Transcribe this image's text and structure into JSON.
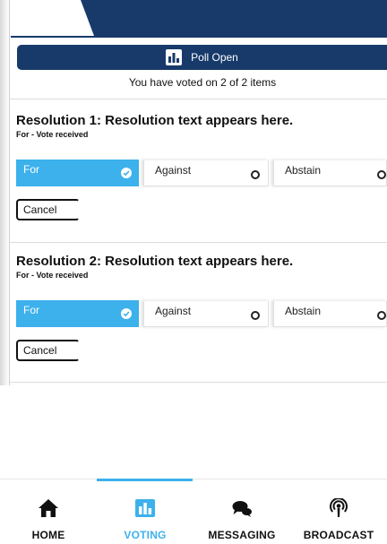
{
  "colors": {
    "navy": "#173a6a",
    "accent": "#3cb1ec",
    "text": "#111111"
  },
  "poll": {
    "status_label": "Poll Open",
    "status_icon": "bar-chart-icon",
    "voted_summary": "You have voted on 2 of 2 items"
  },
  "resolutions": [
    {
      "title": "Resolution 1: Resolution text appears here.",
      "status": "For - Vote received",
      "options": [
        {
          "label": "For",
          "selected": true
        },
        {
          "label": "Against",
          "selected": false
        },
        {
          "label": "Abstain",
          "selected": false
        }
      ],
      "cancel_label": "Cancel"
    },
    {
      "title": "Resolution 2: Resolution text appears here.",
      "status": "For - Vote received",
      "options": [
        {
          "label": "For",
          "selected": true
        },
        {
          "label": "Against",
          "selected": false
        },
        {
          "label": "Abstain",
          "selected": false
        }
      ],
      "cancel_label": "Cancel"
    }
  ],
  "nav": {
    "items": [
      {
        "label": "HOME",
        "icon": "home-icon",
        "active": false
      },
      {
        "label": "VOTING",
        "icon": "bar-chart-icon",
        "active": true
      },
      {
        "label": "MESSAGING",
        "icon": "chat-bubbles-icon",
        "active": false
      },
      {
        "label": "BROADCAST",
        "icon": "broadcast-icon",
        "active": false
      }
    ]
  }
}
